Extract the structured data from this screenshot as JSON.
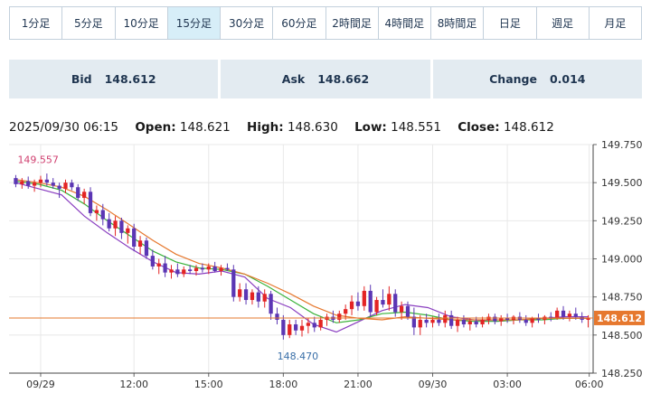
{
  "timeframe_tabs": [
    "1分足",
    "5分足",
    "10分足",
    "15分足",
    "30分足",
    "60分足",
    "2時間足",
    "4時間足",
    "8時間足",
    "日足",
    "週足",
    "月足"
  ],
  "active_tab": "15分足",
  "quotes": {
    "bid_label": "Bid",
    "bid_value": "148.612",
    "ask_label": "Ask",
    "ask_value": "148.662",
    "change_label": "Change",
    "change_value": "0.014"
  },
  "ohlc": {
    "datetime": "2025/09/30 06:15",
    "open_label": "Open:",
    "open": "148.621",
    "high_label": "High:",
    "high": "148.630",
    "low_label": "Low:",
    "low": "148.551",
    "close_label": "Close:",
    "close": "148.612"
  },
  "colors": {
    "up": "#e32424",
    "down": "#5b36b4",
    "ma_short": "#8a3ec0",
    "ma_mid": "#3bb33b",
    "ma_long": "#e6782e",
    "price_line": "#e6782e",
    "high_label": "#d04070",
    "low_label": "#3a6fa8",
    "tab_active_bg": "#d7eef8",
    "quote_bg": "#e3ebf1"
  },
  "chart_data": {
    "type": "candlestick",
    "ylim": [
      148.25,
      149.75
    ],
    "y_ticks": [
      "149.750",
      "149.500",
      "149.250",
      "149.000",
      "148.750",
      "148.500",
      "148.250"
    ],
    "x_ticks": [
      "09/29",
      "12:00",
      "15:00",
      "18:00",
      "21:00",
      "09/30",
      "03:00",
      "06:00"
    ],
    "current_price": "148.612",
    "max_label": "149.557",
    "min_label": "148.470",
    "grid": true,
    "series": [
      {
        "name": "MA short",
        "values": [
          149.5,
          149.46,
          149.42,
          149.28,
          149.17,
          149.07,
          148.98,
          148.91,
          148.9,
          148.92,
          148.88,
          148.74,
          148.68,
          148.57,
          148.52,
          148.59,
          148.66,
          148.7,
          148.68,
          148.62,
          148.6,
          148.59,
          148.6,
          148.61,
          148.62,
          148.62
        ]
      },
      {
        "name": "MA mid",
        "values": [
          149.51,
          149.49,
          149.45,
          149.36,
          149.25,
          149.15,
          149.05,
          148.98,
          148.94,
          148.93,
          148.9,
          148.82,
          148.73,
          148.64,
          148.58,
          148.6,
          148.64,
          148.65,
          148.63,
          148.6,
          148.59,
          148.59,
          148.6,
          148.6,
          148.61,
          148.61
        ]
      },
      {
        "name": "MA long",
        "values": [
          149.52,
          149.5,
          149.47,
          149.41,
          149.32,
          149.22,
          149.12,
          149.03,
          148.97,
          148.94,
          148.9,
          148.84,
          148.77,
          148.69,
          148.63,
          148.61,
          148.6,
          148.62,
          148.61,
          148.6,
          148.6,
          148.6,
          148.6,
          148.61,
          148.61,
          148.61
        ]
      }
    ],
    "candles": [
      [
        149.53,
        149.55,
        149.47,
        149.49
      ],
      [
        149.49,
        149.53,
        149.46,
        149.51
      ],
      [
        149.51,
        149.54,
        149.46,
        149.48
      ],
      [
        149.48,
        149.52,
        149.44,
        149.5
      ],
      [
        149.5,
        149.545,
        149.47,
        149.52
      ],
      [
        149.52,
        149.56,
        149.48,
        149.5
      ],
      [
        149.5,
        149.53,
        149.46,
        149.48
      ],
      [
        149.48,
        149.5,
        149.4,
        149.46
      ],
      [
        149.46,
        149.52,
        149.43,
        149.5
      ],
      [
        149.5,
        149.52,
        149.45,
        149.47
      ],
      [
        149.47,
        149.49,
        149.38,
        149.4
      ],
      [
        149.4,
        149.46,
        149.36,
        149.44
      ],
      [
        149.44,
        149.47,
        149.28,
        149.3
      ],
      [
        149.3,
        149.35,
        149.25,
        149.32
      ],
      [
        149.32,
        149.36,
        149.22,
        149.26
      ],
      [
        149.26,
        149.3,
        149.18,
        149.2
      ],
      [
        149.2,
        149.28,
        149.15,
        149.25
      ],
      [
        149.25,
        149.27,
        149.13,
        149.17
      ],
      [
        149.17,
        149.22,
        149.1,
        149.2
      ],
      [
        149.2,
        149.23,
        149.05,
        149.08
      ],
      [
        149.08,
        149.15,
        149.03,
        149.12
      ],
      [
        149.12,
        149.14,
        149.0,
        149.02
      ],
      [
        149.02,
        149.06,
        148.93,
        148.95
      ],
      [
        148.95,
        149.0,
        148.9,
        148.97
      ],
      [
        148.97,
        149.02,
        148.88,
        148.91
      ],
      [
        148.91,
        148.96,
        148.87,
        148.93
      ],
      [
        148.93,
        148.97,
        148.88,
        148.9
      ],
      [
        148.9,
        148.95,
        148.88,
        148.93
      ],
      [
        148.93,
        148.96,
        148.9,
        148.92
      ],
      [
        148.92,
        148.96,
        148.89,
        148.94
      ],
      [
        148.94,
        148.97,
        148.91,
        148.93
      ],
      [
        148.93,
        148.97,
        148.9,
        148.95
      ],
      [
        148.95,
        148.98,
        148.91,
        148.92
      ],
      [
        148.92,
        148.96,
        148.89,
        148.94
      ],
      [
        148.94,
        148.97,
        148.92,
        148.93
      ],
      [
        148.93,
        148.96,
        148.72,
        148.75
      ],
      [
        148.75,
        148.84,
        148.72,
        148.8
      ],
      [
        148.8,
        148.84,
        148.7,
        148.73
      ],
      [
        148.73,
        148.8,
        148.7,
        148.78
      ],
      [
        148.78,
        148.82,
        148.68,
        148.72
      ],
      [
        148.72,
        148.8,
        148.68,
        148.77
      ],
      [
        148.77,
        148.79,
        148.6,
        148.64
      ],
      [
        148.64,
        148.68,
        148.57,
        148.6
      ],
      [
        148.6,
        148.63,
        148.47,
        148.5
      ],
      [
        148.5,
        148.6,
        148.48,
        148.57
      ],
      [
        148.57,
        148.6,
        148.5,
        148.53
      ],
      [
        148.53,
        148.6,
        148.49,
        148.56
      ],
      [
        148.56,
        148.61,
        148.51,
        148.58
      ],
      [
        148.58,
        148.62,
        148.52,
        148.55
      ],
      [
        148.55,
        148.62,
        148.53,
        148.6
      ],
      [
        148.6,
        148.64,
        148.56,
        148.62
      ],
      [
        148.62,
        148.66,
        148.58,
        148.6
      ],
      [
        148.6,
        148.66,
        148.58,
        148.64
      ],
      [
        148.64,
        148.7,
        148.6,
        148.67
      ],
      [
        148.67,
        148.76,
        148.63,
        148.72
      ],
      [
        148.72,
        148.78,
        148.66,
        148.69
      ],
      [
        148.69,
        148.82,
        148.66,
        148.79
      ],
      [
        148.79,
        148.83,
        148.62,
        148.65
      ],
      [
        148.65,
        148.75,
        148.63,
        148.73
      ],
      [
        148.73,
        148.8,
        148.68,
        148.7
      ],
      [
        148.7,
        148.82,
        148.66,
        148.77
      ],
      [
        148.77,
        148.8,
        148.62,
        148.65
      ],
      [
        148.65,
        148.72,
        148.6,
        148.69
      ],
      [
        148.69,
        148.72,
        148.6,
        148.62
      ],
      [
        148.62,
        148.68,
        148.5,
        148.55
      ],
      [
        148.55,
        148.63,
        148.5,
        148.6
      ],
      [
        148.6,
        148.64,
        148.55,
        148.58
      ],
      [
        148.58,
        148.62,
        148.55,
        148.6
      ],
      [
        148.6,
        148.64,
        148.56,
        148.58
      ],
      [
        148.58,
        148.66,
        148.55,
        148.63
      ],
      [
        148.63,
        148.66,
        148.54,
        148.56
      ],
      [
        148.56,
        148.62,
        148.52,
        148.6
      ],
      [
        148.6,
        148.63,
        148.55,
        148.57
      ],
      [
        148.57,
        148.61,
        148.53,
        148.59
      ],
      [
        148.59,
        148.62,
        148.55,
        148.57
      ],
      [
        148.57,
        148.62,
        148.55,
        148.6
      ],
      [
        148.6,
        148.64,
        148.57,
        148.62
      ],
      [
        148.62,
        148.64,
        148.57,
        148.59
      ],
      [
        148.59,
        148.63,
        148.56,
        148.61
      ],
      [
        148.61,
        148.64,
        148.58,
        148.6
      ],
      [
        148.6,
        148.63,
        148.57,
        148.62
      ],
      [
        148.62,
        148.65,
        148.58,
        148.6
      ],
      [
        148.6,
        148.63,
        148.56,
        148.58
      ],
      [
        148.58,
        148.62,
        148.55,
        148.61
      ],
      [
        148.61,
        148.64,
        148.58,
        148.6
      ],
      [
        148.6,
        148.63,
        148.57,
        148.62
      ],
      [
        148.62,
        148.65,
        148.59,
        148.61
      ],
      [
        148.61,
        148.68,
        148.6,
        148.66
      ],
      [
        148.66,
        148.69,
        148.6,
        148.62
      ],
      [
        148.62,
        148.66,
        148.59,
        148.64
      ],
      [
        148.64,
        148.68,
        148.6,
        148.62
      ],
      [
        148.62,
        148.65,
        148.58,
        148.6
      ],
      [
        148.6,
        148.63,
        148.55,
        148.61
      ]
    ]
  }
}
